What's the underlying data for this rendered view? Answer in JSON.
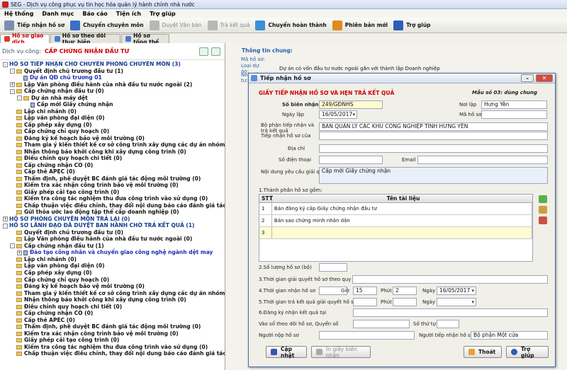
{
  "window_title": "SEG - Dịch vụ công phục vụ tin học hóa quản lý hành chính nhà nước",
  "menu": [
    "Hệ thống",
    "Danh mục",
    "Báo cáo",
    "Tiện ích",
    "Trợ giúp"
  ],
  "toolbar": [
    {
      "label": "Tiếp nhận hồ sơ",
      "icon": "intake-icon",
      "color": "#7a8fb0",
      "disabled": false
    },
    {
      "label": "Chuyển chuyên môn",
      "icon": "transfer-user-icon",
      "color": "#3a6fc8",
      "disabled": false
    },
    {
      "label": "Duyệt Văn bản",
      "icon": "approve-doc-icon",
      "color": "#b8b8b8",
      "disabled": true
    },
    {
      "label": "Trả kết quả",
      "icon": "return-result-icon",
      "color": "#b8b8b8",
      "disabled": true
    },
    {
      "label": "Chuyển hoàn thành",
      "icon": "complete-transfer-icon",
      "color": "#3a8fd8",
      "disabled": false
    },
    {
      "label": "Phiên bản mới",
      "icon": "new-version-icon",
      "color": "#e08a20",
      "disabled": false
    },
    {
      "label": "Trợ giúp",
      "icon": "help-icon",
      "color": "#2d5fb8",
      "disabled": false
    }
  ],
  "tabs": [
    "Hồ sơ giao dịch",
    "Hồ sơ theo dõi thực hiện",
    "Hồ sơ tổng thể"
  ],
  "service": {
    "label": "Dịch vụ công:",
    "value": "CẤP CHỨNG NHẬN ĐẦU TƯ"
  },
  "tree": [
    {
      "text": "HỒ SƠ TIẾP NHẬN CHỜ CHUYỂN PHÒNG CHUYÊN MÔN (3)",
      "level": 0,
      "toggle": "-",
      "kind": "root"
    },
    {
      "text": "Quyết định chủ trương đầu tư (1)",
      "level": 1,
      "toggle": "-",
      "kind": "folder"
    },
    {
      "text": "Dự án QĐ chủ trương 01",
      "level": 2,
      "toggle": "",
      "kind": "blue"
    },
    {
      "text": "Lập Văn phòng điều hành của nhà đầu tư nước ngoài (2)",
      "level": 1,
      "toggle": "+",
      "kind": "folder"
    },
    {
      "text": "Cấp chứng nhận đầu tư (0)",
      "level": 1,
      "toggle": "-",
      "kind": "folder"
    },
    {
      "text": "Dự án nhà máy dệt",
      "level": 2,
      "toggle": "-",
      "kind": "folder"
    },
    {
      "text": "Cấp mới Giấy chứng nhận",
      "level": 3,
      "toggle": "",
      "kind": "doc"
    },
    {
      "text": "Lập chi nhánh (0)",
      "level": 1,
      "toggle": "",
      "kind": "folder"
    },
    {
      "text": "Lập văn phòng đại diện (0)",
      "level": 1,
      "toggle": "",
      "kind": "folder"
    },
    {
      "text": "Cấp phép xây dựng (0)",
      "level": 1,
      "toggle": "",
      "kind": "folder"
    },
    {
      "text": "Cấp chứng chỉ quy hoạch (0)",
      "level": 1,
      "toggle": "",
      "kind": "folder"
    },
    {
      "text": "Đăng ký kế hoạch bảo vệ môi trường (0)",
      "level": 1,
      "toggle": "",
      "kind": "folder"
    },
    {
      "text": "Tham gia ý kiến thiết kế cơ sở công trình xây dựng các dự án nhóm B và C (0)",
      "level": 1,
      "toggle": "",
      "kind": "folder"
    },
    {
      "text": "Nhận thông báo khởi công khi xây dựng công trình (0)",
      "level": 1,
      "toggle": "",
      "kind": "folder"
    },
    {
      "text": "Điều chỉnh quy hoạch chi tiết (0)",
      "level": 1,
      "toggle": "",
      "kind": "folder"
    },
    {
      "text": "Cấp chứng nhận CO (0)",
      "level": 1,
      "toggle": "",
      "kind": "folder"
    },
    {
      "text": "Cấp thẻ APEC (0)",
      "level": 1,
      "toggle": "",
      "kind": "folder"
    },
    {
      "text": "Thẩm định, phê duyệt BC đánh giá tác động môi trường (0)",
      "level": 1,
      "toggle": "",
      "kind": "folder"
    },
    {
      "text": "Kiểm tra xác nhận công trình bảo vệ môi trường (0)",
      "level": 1,
      "toggle": "",
      "kind": "folder"
    },
    {
      "text": "Giấy phép cải tạo công trình (0)",
      "level": 1,
      "toggle": "",
      "kind": "folder"
    },
    {
      "text": "Kiểm tra công tác nghiệm thu đưa công trình vào sử dụng (0)",
      "level": 1,
      "toggle": "",
      "kind": "folder"
    },
    {
      "text": "Chấp thuận việc điều chỉnh, thay đổi nội dung báo cáo đánh giá tác động môi trường (0)",
      "level": 1,
      "toggle": "",
      "kind": "folder"
    },
    {
      "text": "Gửi thỏa ước lao động tập thể cấp doanh nghiệp (0)",
      "level": 1,
      "toggle": "",
      "kind": "folder"
    },
    {
      "text": "HỒ SƠ PHÒNG CHUYÊN MÔN TRẢ LẠI (0)",
      "level": 0,
      "toggle": "+",
      "kind": "root"
    },
    {
      "text": "HỒ SƠ LÃNH ĐẠO ĐÃ DUYỆT BAN HÀNH CHỜ TRẢ KẾT QUẢ (1)",
      "level": 0,
      "toggle": "-",
      "kind": "root"
    },
    {
      "text": "Quyết định chủ trương đầu tư (0)",
      "level": 1,
      "toggle": "",
      "kind": "folder"
    },
    {
      "text": "Lập Văn phòng điều hành của nhà đầu tư nước ngoài (0)",
      "level": 1,
      "toggle": "",
      "kind": "folder"
    },
    {
      "text": "Cấp chứng nhận đầu tư (1)",
      "level": 1,
      "toggle": "-",
      "kind": "folder"
    },
    {
      "text": "Đào tạo công nhân và chuyển giao công nghệ ngành dệt may",
      "level": 2,
      "toggle": "+",
      "kind": "blue"
    },
    {
      "text": "Lập chi nhánh (0)",
      "level": 1,
      "toggle": "",
      "kind": "folder"
    },
    {
      "text": "Lập văn phòng đại diện (0)",
      "level": 1,
      "toggle": "",
      "kind": "folder"
    },
    {
      "text": "Cấp phép xây dựng (0)",
      "level": 1,
      "toggle": "",
      "kind": "folder"
    },
    {
      "text": "Cấp chứng chỉ quy hoạch (0)",
      "level": 1,
      "toggle": "",
      "kind": "folder"
    },
    {
      "text": "Đăng ký kế hoạch bảo vệ môi trường (0)",
      "level": 1,
      "toggle": "",
      "kind": "folder"
    },
    {
      "text": "Tham gia ý kiến thiết kế cơ sở công trình xây dựng các dự án nhóm B và C (0)",
      "level": 1,
      "toggle": "",
      "kind": "folder"
    },
    {
      "text": "Nhận thông báo khởi công khi xây dựng công trình (0)",
      "level": 1,
      "toggle": "",
      "kind": "folder"
    },
    {
      "text": "Điều chỉnh quy hoạch chi tiết (0)",
      "level": 1,
      "toggle": "",
      "kind": "folder"
    },
    {
      "text": "Cấp chứng nhận CO (0)",
      "level": 1,
      "toggle": "",
      "kind": "folder"
    },
    {
      "text": "Cấp thẻ APEC (0)",
      "level": 1,
      "toggle": "",
      "kind": "folder"
    },
    {
      "text": "Thẩm định, phê duyệt BC đánh giá tác động môi trường (0)",
      "level": 1,
      "toggle": "",
      "kind": "folder"
    },
    {
      "text": "Kiểm tra xác nhận công trình bảo vệ môi trường (0)",
      "level": 1,
      "toggle": "",
      "kind": "folder"
    },
    {
      "text": "Giấy phép cải tạo công trình (0)",
      "level": 1,
      "toggle": "",
      "kind": "folder"
    },
    {
      "text": "Kiểm tra công tác nghiệm thu đưa công trình vào sử dụng (0)",
      "level": 1,
      "toggle": "",
      "kind": "folder"
    },
    {
      "text": "Chấp thuận việc điều chỉnh, thay đổi nội dung báo cáo đánh giá tác động môi trường (0)",
      "level": 1,
      "toggle": "",
      "kind": "folder"
    }
  ],
  "info": {
    "heading": "Thông tin chung:",
    "rows": [
      {
        "label": "Mã hồ sơ:",
        "value": ""
      },
      {
        "label": "Loại dự án:",
        "value": "Dự án có vốn đầu tư nước ngoài gắn với thành lập Doanh nghiệp"
      },
      {
        "label": "Nhà đầu tư:",
        "value": ""
      }
    ]
  },
  "dialog": {
    "title": "Tiếp nhận hồ sơ",
    "heading": "GIẤY TIẾP NHẬN HỒ SƠ VÀ HẸN TRẢ KẾT QUẢ",
    "form_code": "Mẫu số 03: dùng chung",
    "so_bien_nhan_label": "Số biên nhận",
    "so_bien_nhan": "249/GĐNHS",
    "noi_lap_label": "Nơi lập",
    "noi_lap": "Hưng Yên",
    "ngay_lap_label": "Ngày lập",
    "ngay_lap": "16/05/2017",
    "ma_ho_so_label": "Mã hồ sơ",
    "bo_phan_label": "Bộ phận tiếp nhận và trả kết quả",
    "bo_phan": "BAN QUẢN LÝ CÁC KHU CÔNG NGHIỆP TỈNH HƯNG YÊN",
    "tiep_nhan_cua_label": "Tiếp nhận hồ sơ của",
    "dia_chi_label": "Địa chỉ",
    "so_dien_thoai_label": "Số điện thoại",
    "email_label": "Email",
    "noi_dung_label": "Nội dung yêu cầu giải quyết",
    "noi_dung": "Cấp mới Giấy chứng nhận",
    "thanh_phan_label": "1.Thành phần hồ sơ gồm:",
    "grid_headers": [
      "STT",
      "Tên tài liệu"
    ],
    "grid_rows": [
      {
        "stt": "1",
        "ten": "Bản đăng ký cấp Giấy chứng nhận đầu tư"
      },
      {
        "stt": "2",
        "ten": "Bản sao chứng minh nhân dân"
      },
      {
        "stt": "3",
        "ten": ""
      }
    ],
    "so_luong_label": "2.Số lượng hồ sơ (bộ)",
    "thoi_gian_quy_dinh_label": "3.Thời gian giải quyết hồ sơ theo quy định là",
    "thoi_gian_nhan_label": "4.Thời gian nhận hồ sơ",
    "gio_label": "Giờ",
    "gio_nhan": "15",
    "phut_label": "Phút",
    "phut_nhan": "2",
    "ngay_label": "Ngày",
    "ngay_nhan": "16/05/2017",
    "thoi_gian_tra_label": "5.Thời gian trả kết quả giải quyết hồ sơ",
    "gio_tra": "",
    "phut_tra": "",
    "ngay_tra": "",
    "dang_ky_label": "6.Đăng ký nhận kết quả tại",
    "vao_so_label": "Vào sổ theo dõi hồ sơ, Quyển số",
    "so_thu_tu_label": "Số thứ tự",
    "nguoi_nop_label": "Người nộp hồ sơ",
    "nguoi_tiep_nhan_label": "Người tiếp nhận hồ sơ",
    "nguoi_tiep_nhan": "Bộ phận Một cửa",
    "buttons": {
      "save": "Cập nhật",
      "print": "In giấy biên nhận",
      "exit": "Thoát",
      "help": "Trợ giúp"
    }
  }
}
